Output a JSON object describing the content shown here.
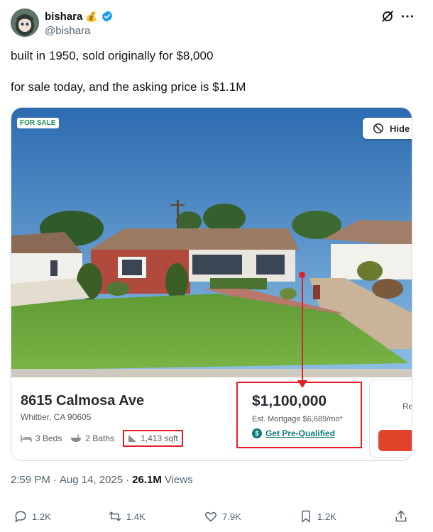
{
  "author": {
    "display_name": "bishara",
    "emoji": "💰",
    "handle": "@bishara"
  },
  "tweet": {
    "line1": "built in 1950, sold originally for $8,000",
    "line2": "for sale today, and the asking price is $1.1M"
  },
  "listing": {
    "badge": "FOR SALE",
    "hide_label": "Hide",
    "address": "8615 Calmosa Ave",
    "city": "Whittier, CA 90605",
    "beds": "3 Beds",
    "baths": "2 Baths",
    "sqft": "1,413 sqft",
    "price": "$1,100,000",
    "mortgage": "Est. Mortgage $6,689/mo*",
    "prequalify": "Get Pre-Qualified",
    "side_label": "Re"
  },
  "meta": {
    "time": "2:59 PM",
    "separator1": "·",
    "date": "Aug 14, 2025",
    "separator2": "·",
    "views_count": "26.1M",
    "views_label": "Views"
  },
  "actions": {
    "replies": "1.2K",
    "reposts": "1.4K",
    "likes": "7.9K",
    "bookmarks": "1.2K"
  },
  "colors": {
    "highlight_red": "#e41e26",
    "teal": "#0d7a7a",
    "verified_blue": "#1d9bf0"
  }
}
